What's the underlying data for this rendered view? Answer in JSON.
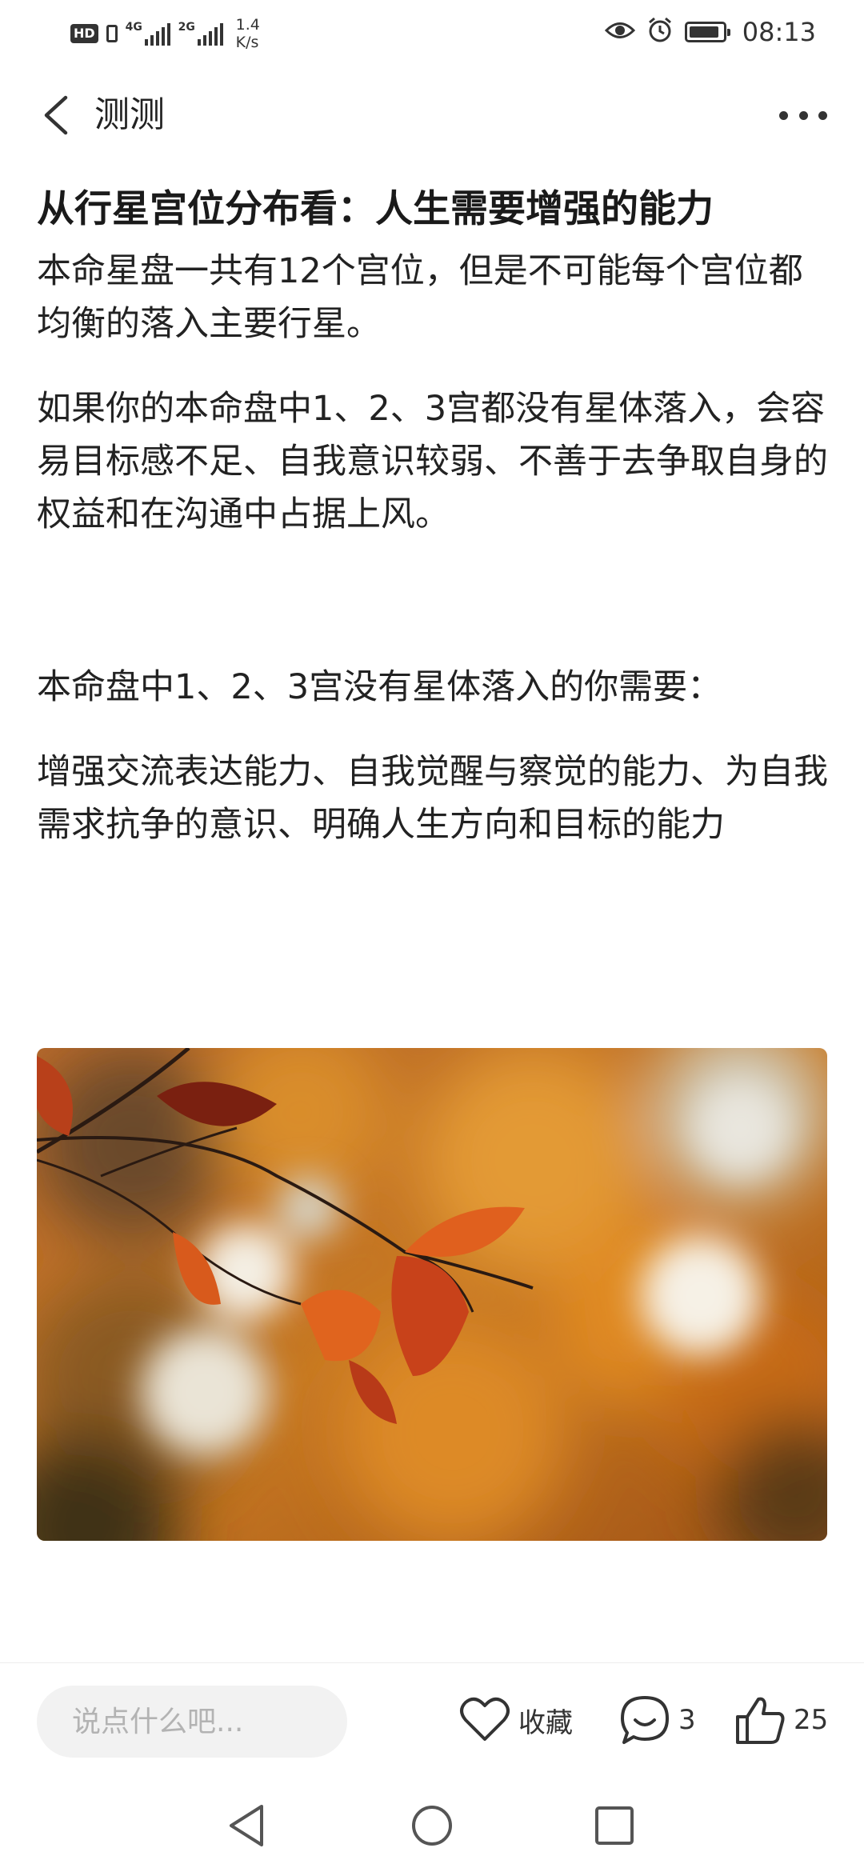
{
  "status_bar": {
    "hd_label": "HD",
    "signal1_label": "4G",
    "signal2_label": "2G",
    "speed_value": "1.4",
    "speed_unit": "K/s",
    "time": "08:13"
  },
  "nav": {
    "title": "测测"
  },
  "article": {
    "heading": "从行星宫位分布看：人生需要增强的能力",
    "paragraphs": [
      "本命星盘一共有12个宫位，但是不可能每个宫位都均衡的落入主要行星。",
      "如果你的本命盘中1、2、3宫都没有星体落入，会容易目标感不足、自我意识较弱、不善于去争取自身的权益和在沟通中占据上风。",
      "本命盘中1、2、3宫没有星体落入的你需要：",
      "增强交流表达能力、自我觉醒与察觉的能力、为自我需求抗争的意识、明确人生方向和目标的能力"
    ]
  },
  "bottom_bar": {
    "comment_placeholder": "说点什么吧...",
    "favorite_label": "收藏",
    "comment_count": "3",
    "like_count": "25"
  },
  "icons": {
    "back": "chevron-left-icon",
    "more": "more-dots-icon",
    "favorite": "heart-icon",
    "comment": "chat-bubble-icon",
    "like": "thumbs-up-icon"
  },
  "colors": {
    "text": "#222222",
    "input_bg": "#f2f2f2",
    "leaf_orange": "#d9531e"
  }
}
